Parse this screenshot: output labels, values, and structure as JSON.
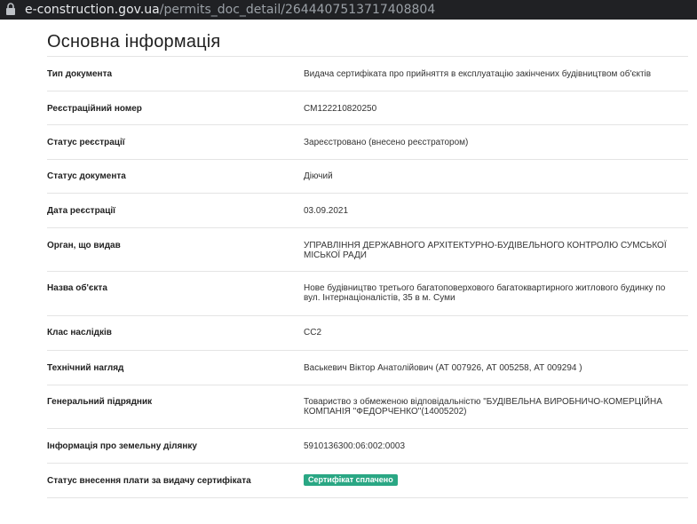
{
  "browser": {
    "url_host": "e-construction.gov.ua",
    "url_path": "/permits_doc_detail/2644407513717408804"
  },
  "page": {
    "title": "Основна інформація"
  },
  "fields": [
    {
      "label": "Тип документа",
      "value": "Видача сертифіката про прийняття в експлуатацію закінчених будівництвом об'єктів"
    },
    {
      "label": "Реєстраційний номер",
      "value": "СМ122210820250"
    },
    {
      "label": "Статус реєстрації",
      "value": "Зареєстровано (внесено реєстратором)"
    },
    {
      "label": "Статус документа",
      "value": "Діючий"
    },
    {
      "label": "Дата реєстрації",
      "value": "03.09.2021"
    },
    {
      "label": "Орган, що видав",
      "value": "УПРАВЛІННЯ ДЕРЖАВНОГО АРХІТЕКТУРНО-БУДІВЕЛЬНОГО КОНТРОЛЮ СУМСЬКОЇ МІСЬКОЇ РАДИ"
    },
    {
      "label": "Назва об'єкта",
      "value": "Нове будівництво третього багатоповерхового багатоквартирного житлового будинку по вул. Інтернаціоналістів, 35 в м. Суми"
    },
    {
      "label": "Клас наслідків",
      "value": "СС2"
    },
    {
      "label": "Технічний нагляд",
      "value": "Васькевич Віктор Анатолійович (АТ 007926, АТ 005258, АТ 009294 )"
    },
    {
      "label": "Генеральний підрядник",
      "value": "Товариство з обмеженою відповідальністю \"БУДІВЕЛЬНА ВИРОБНИЧО-КОМЕРЦІЙНА КОМПАНІЯ \"ФЕДОРЧЕНКО\"(14005202)"
    },
    {
      "label": "Інформація про земельну ділянку",
      "value": "5910136300:06:002:0003"
    },
    {
      "label": "Статус внесення плати за видачу сертифіката",
      "value": "Сертифікат сплачено"
    }
  ],
  "badge_color": "#2aa784"
}
